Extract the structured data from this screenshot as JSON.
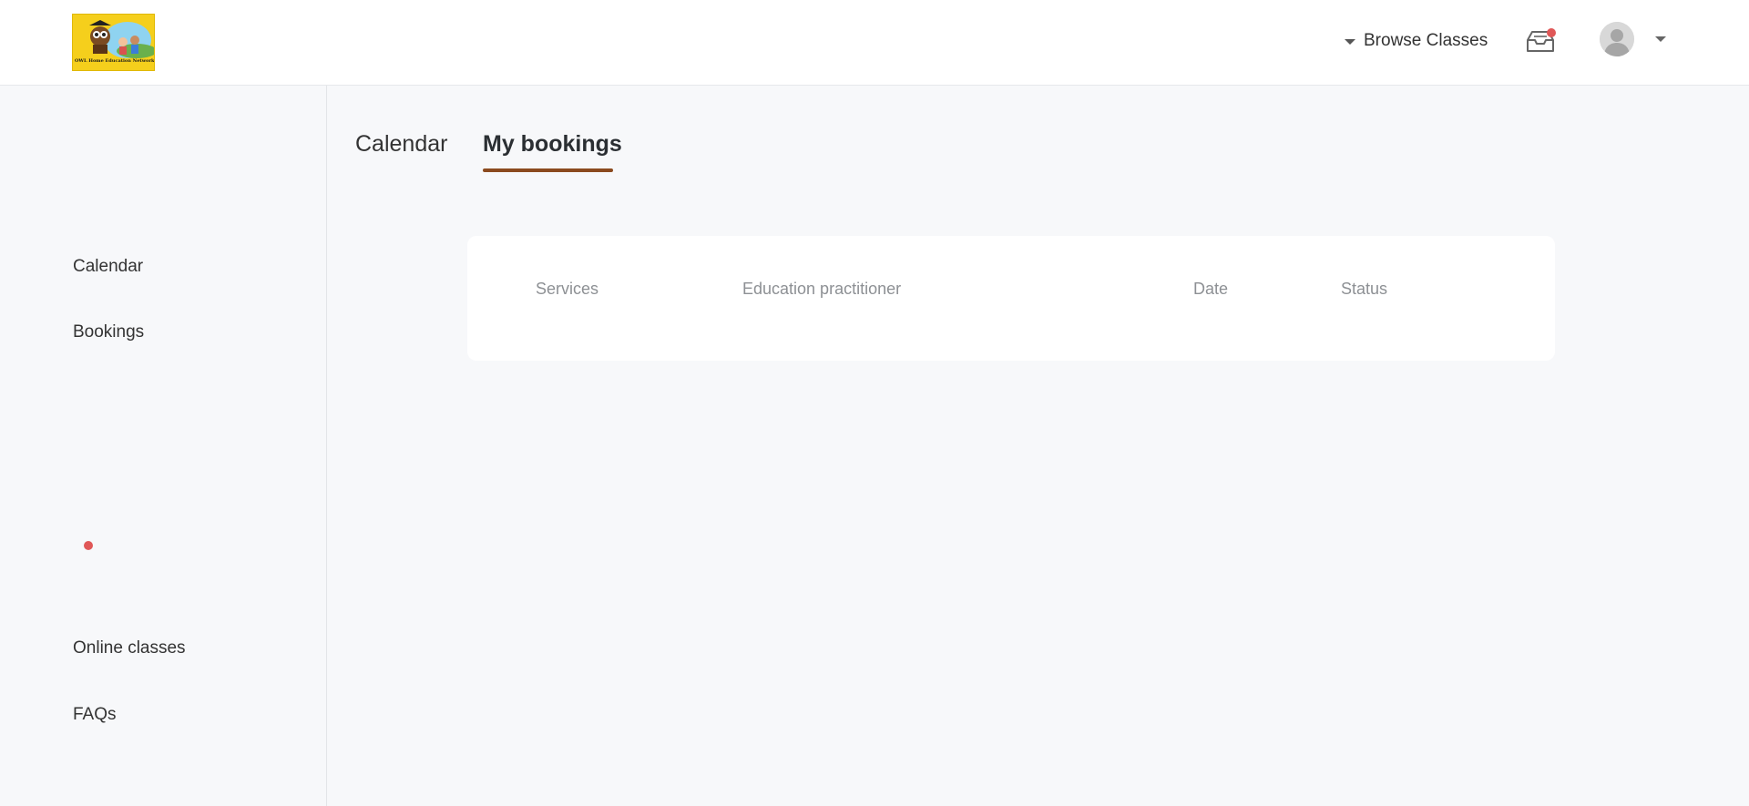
{
  "header": {
    "logo_text": "OWL Home Education Network",
    "browse_label": "Browse Classes",
    "inbox_icon": "inbox-icon",
    "user_icon": "user-avatar-icon"
  },
  "sidebar": {
    "items": [
      {
        "label": "Calendar"
      },
      {
        "label": "Bookings"
      },
      {
        "label": "Online classes"
      },
      {
        "label": "FAQs"
      }
    ]
  },
  "tabs": [
    {
      "label": "Calendar",
      "active": false
    },
    {
      "label": "My bookings",
      "active": true
    }
  ],
  "bookings_table": {
    "columns": [
      "Services",
      "Education practitioner",
      "Date",
      "Status"
    ],
    "rows": []
  },
  "colors": {
    "accent": "#8b4a1f",
    "notification": "#e05757",
    "logo_background": "#f5cf1c",
    "page_background": "#f7f8fa"
  }
}
